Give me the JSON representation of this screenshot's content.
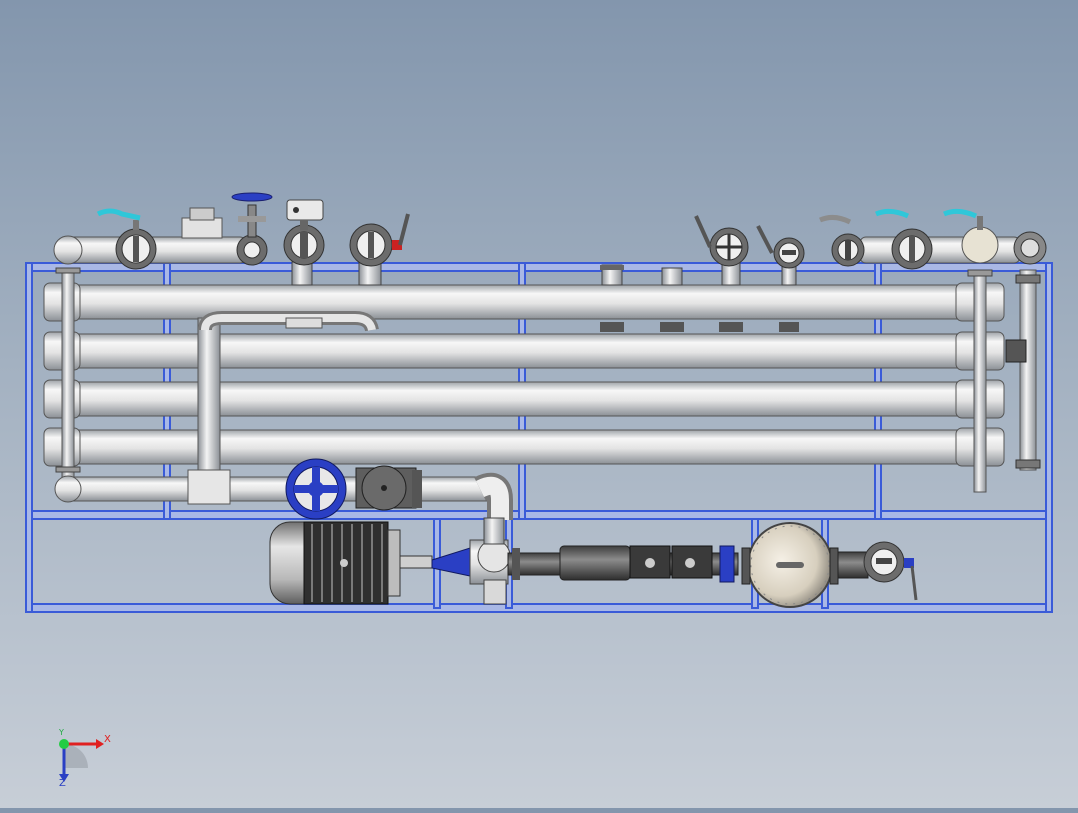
{
  "colors": {
    "background_top": "#8396ad",
    "background_bottom": "#c7ced7",
    "frame": "#3a5bd8",
    "frame_fill": "#a9b8e6",
    "pipe_light": "#f2f2f2",
    "pipe_shade": "#9ea3a8",
    "handle_cyan": "#2fc7d9",
    "handle_gray": "#8c8c8c",
    "actuator_red": "#cc2222",
    "motor_dark": "#3a3a3a",
    "valve_blue": "#2a3fc4"
  },
  "icons": {
    "valves_top": "butterfly-valve-icon",
    "globe_valve": "handwheel-globe-valve-icon",
    "actuator": "pneumatic-actuator-icon",
    "motor": "electric-motor-icon",
    "pump": "centrifugal-pump-icon",
    "filter": "cartridge-filter-housing-icon",
    "triad": "coordinate-triad-icon"
  },
  "triad": {
    "x_label": "X",
    "y_label": "Y",
    "z_label": "Z"
  }
}
